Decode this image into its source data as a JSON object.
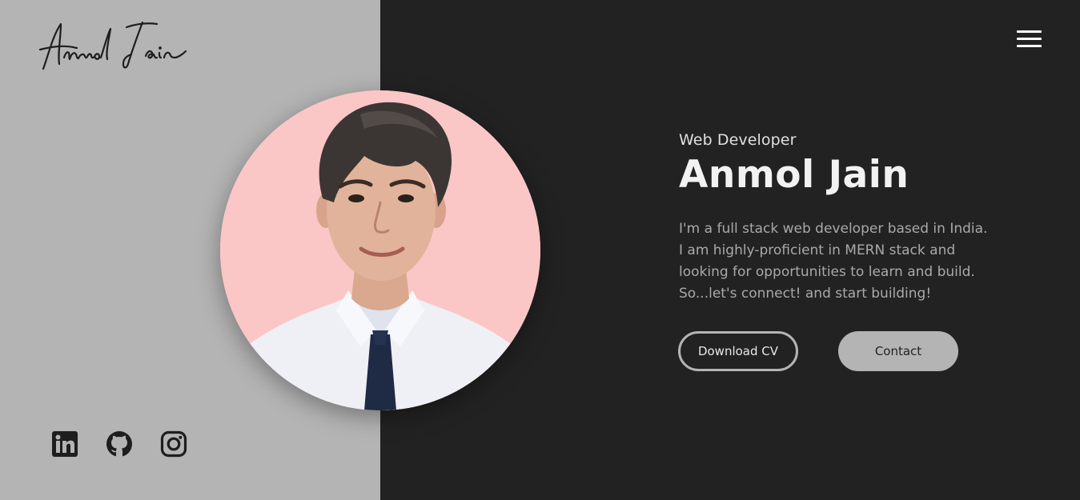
{
  "colors": {
    "left_panel": "#b4b4b4",
    "right_panel": "#222222",
    "portrait_bg": "#fbc6c6",
    "accent": "#b4b4b4"
  },
  "header": {
    "logo_text": "Anmol Jain",
    "menu_icon": "hamburger-menu-icon"
  },
  "hero": {
    "role": "Web Developer",
    "name": "Anmol Jain",
    "bio": "I'm a full stack web developer based in India. I am highly-proficient in MERN stack and looking for opportunities to learn and build. So...let's connect! and start building!",
    "buttons": {
      "download_cv": "Download CV",
      "contact": "Contact"
    }
  },
  "socials": [
    {
      "icon": "linkedin-icon"
    },
    {
      "icon": "github-icon"
    },
    {
      "icon": "instagram-icon"
    }
  ]
}
